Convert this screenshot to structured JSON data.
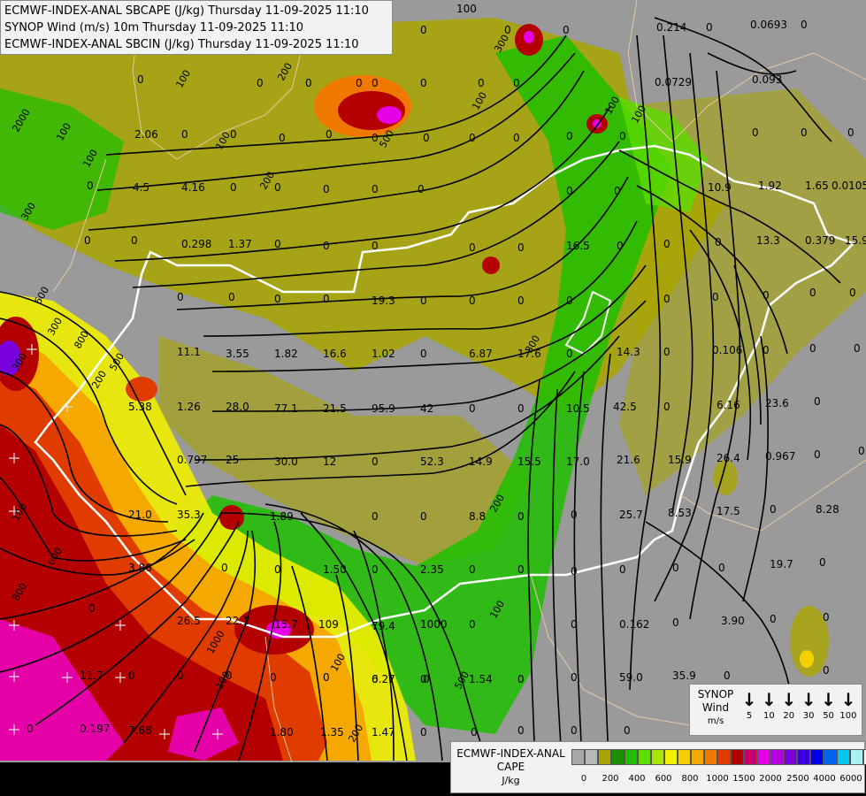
{
  "header": {
    "line1": "ECMWF-INDEX-ANAL SBCAPE (J/kg) Thursday 11-09-2025 11:10",
    "line2": "SYNOP Wind (m/s) 10m Thursday 11-09-2025 11:10",
    "line3": "ECMWF-INDEX-ANAL SBCIN (J/kg) Thursday 11-09-2025 11:10"
  },
  "wind_legend": {
    "title": "SYNOP",
    "subtitle": "Wind",
    "unit": "m/s",
    "arrow_icon": "down-arrow-icon",
    "speeds": [
      "5",
      "10",
      "20",
      "30",
      "50",
      "100"
    ]
  },
  "cape_legend": {
    "title": "ECMWF-INDEX-ANAL",
    "subtitle": "CAPE",
    "unit": "J/kg",
    "colors": [
      "#a8a8a8",
      "#b8b8b8",
      "#a9a500",
      "#1e8f00",
      "#1fbf00",
      "#5ddc00",
      "#a8e600",
      "#f0f000",
      "#f5d000",
      "#f5a800",
      "#f07800",
      "#e03c00",
      "#b40000",
      "#c8006e",
      "#e600e6",
      "#b400dc",
      "#7800dc",
      "#3c00dc",
      "#0000e6",
      "#0064f0",
      "#00c8f0",
      "#aaf0f0",
      "#ffffff"
    ],
    "ticks": [
      "0",
      "200",
      "400",
      "600",
      "800",
      "1000",
      "1500",
      "2000",
      "2500",
      "4000",
      "6000"
    ]
  },
  "map_labels": {
    "cin": [
      "100",
      "0",
      "0",
      "0",
      "0.214",
      "0",
      "0.0693",
      "0",
      "0",
      "0",
      "0",
      "0",
      "0.0729",
      "0.093",
      "0",
      "0",
      "0",
      "0",
      "2.06",
      "0",
      "0",
      "0",
      "0",
      "0",
      "0",
      "0",
      "0",
      "0",
      "0",
      "0",
      "0",
      "0",
      "0",
      "4.5",
      "4.16",
      "0",
      "0",
      "0",
      "0",
      "0",
      "0",
      "0",
      "10.9",
      "1.92",
      "1.65",
      "0.0105",
      "0",
      "0",
      "0.298",
      "1.37",
      "0",
      "0",
      "0",
      "0",
      "0",
      "16.5",
      "0",
      "0",
      "0",
      "13.3",
      "0.379",
      "15.9",
      "0",
      "0",
      "0",
      "0",
      "19.3",
      "0",
      "0",
      "0",
      "0",
      "0",
      "0",
      "0",
      "0",
      "0",
      "11.1",
      "3.55",
      "1.82",
      "16.6",
      "1.02",
      "0",
      "6.87",
      "17.6",
      "0",
      "14.3",
      "0",
      "0.106",
      "0",
      "0",
      "0",
      "5.38",
      "1.26",
      "28.0",
      "77.1",
      "21.5",
      "95.9",
      "42",
      "0",
      "0",
      "10.5",
      "42.5",
      "0",
      "6.16",
      "23.6",
      "0",
      "0.797",
      "25",
      "30.0",
      "12",
      "0",
      "52.3",
      "14.9",
      "15.5",
      "17.0",
      "21.6",
      "15.9",
      "26.4",
      "0.967",
      "0",
      "0",
      "21.0",
      "35.3",
      "1.89",
      "0",
      "0",
      "8.8",
      "0",
      "0",
      "25.7",
      "8.53",
      "17.5",
      "0",
      "8.28",
      "3.86",
      "0",
      "0",
      "1.50",
      "0",
      "2.35",
      "0",
      "0",
      "0",
      "0",
      "0",
      "0",
      "19.7",
      "0",
      "0",
      "26.5",
      "22.1",
      "15.7",
      "1000",
      "0",
      "0",
      "0.162",
      "0",
      "3.90",
      "0",
      "0",
      "109",
      "79.4",
      "11.7",
      "0",
      "0",
      "0",
      "0",
      "0",
      "0",
      "0",
      "1.54",
      "0",
      "0",
      "59.0",
      "35.9",
      "0",
      "0",
      "0",
      "0.197",
      "7.68",
      "1.80",
      "1.35",
      "6.27",
      "0",
      "1.47",
      "0",
      "0",
      "0",
      "0",
      "0"
    ],
    "cape_contours": [
      "100",
      "200",
      "100",
      "2000",
      "100",
      "300",
      "100",
      "200",
      "300",
      "500",
      "100",
      "600",
      "800",
      "500",
      "300",
      "200",
      "300",
      "100",
      "600",
      "800",
      "1000",
      "100",
      "100",
      "200",
      "500",
      "100",
      "200",
      "300",
      "100",
      "100"
    ]
  }
}
